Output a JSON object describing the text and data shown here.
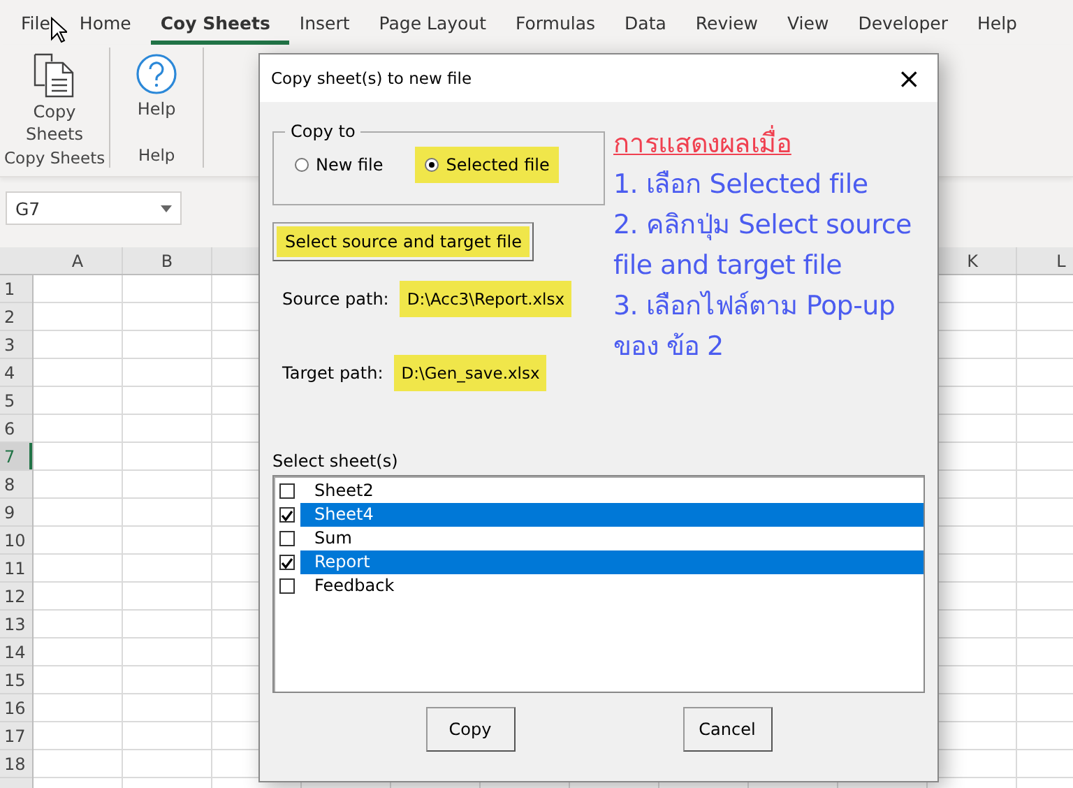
{
  "ribbon_tabs": [
    {
      "label": "File",
      "selected": false
    },
    {
      "label": "Home",
      "selected": false
    },
    {
      "label": "Coy Sheets",
      "selected": true
    },
    {
      "label": "Insert",
      "selected": false
    },
    {
      "label": "Page Layout",
      "selected": false
    },
    {
      "label": "Formulas",
      "selected": false
    },
    {
      "label": "Data",
      "selected": false
    },
    {
      "label": "Review",
      "selected": false
    },
    {
      "label": "View",
      "selected": false
    },
    {
      "label": "Developer",
      "selected": false
    },
    {
      "label": "Help",
      "selected": false
    }
  ],
  "ribbon_groups": [
    {
      "name": "Copy Sheets",
      "button": {
        "label": "Copy Sheets",
        "kind": "copy"
      }
    },
    {
      "name": "Help",
      "button": {
        "label": "Help",
        "kind": "help"
      }
    }
  ],
  "name_box": {
    "value": "G7"
  },
  "sheet": {
    "columns_left": [
      "A",
      "B"
    ],
    "columns_right": [
      "K",
      "L"
    ],
    "rows": [
      {
        "label": "1",
        "selected": false
      },
      {
        "label": "2",
        "selected": false
      },
      {
        "label": "3",
        "selected": false
      },
      {
        "label": "4",
        "selected": false
      },
      {
        "label": "5",
        "selected": false
      },
      {
        "label": "6",
        "selected": false
      },
      {
        "label": "7",
        "selected": true
      },
      {
        "label": "8",
        "selected": false
      },
      {
        "label": "9",
        "selected": false
      },
      {
        "label": "10",
        "selected": false
      },
      {
        "label": "11",
        "selected": false
      },
      {
        "label": "12",
        "selected": false
      },
      {
        "label": "13",
        "selected": false
      },
      {
        "label": "14",
        "selected": false
      },
      {
        "label": "15",
        "selected": false
      },
      {
        "label": "16",
        "selected": false
      },
      {
        "label": "17",
        "selected": false
      },
      {
        "label": "18",
        "selected": false
      }
    ]
  },
  "dialog": {
    "title": "Copy sheet(s) to new file",
    "close": "×",
    "copy_to": {
      "legend": "Copy to",
      "options": [
        {
          "label": "New file",
          "selected": false,
          "highlighted": false
        },
        {
          "label": "Selected file",
          "selected": true,
          "highlighted": true
        }
      ]
    },
    "select_button": "Select source and target file",
    "source_path": {
      "label": "Source path:",
      "value": "D:\\Acc3\\Report.xlsx"
    },
    "target_path": {
      "label": "Target path:",
      "value": "D:\\Gen_save.xlsx"
    },
    "sheets_label": "Select sheet(s)",
    "sheets": [
      {
        "name": "Sheet2",
        "checked": false,
        "selected": false
      },
      {
        "name": "Sheet4",
        "checked": true,
        "selected": true
      },
      {
        "name": "Sum",
        "checked": false,
        "selected": false
      },
      {
        "name": "Report",
        "checked": true,
        "selected": true
      },
      {
        "name": "Feedback",
        "checked": false,
        "selected": false
      }
    ],
    "buttons": [
      "Copy",
      "Cancel"
    ]
  },
  "annotation": {
    "heading": "การแสดงผลเมื่อ",
    "steps": [
      "1. เลือก Selected file",
      "2. คลิกปุ่ม Select source file and target file",
      "3. เลือกไฟล์ตาม Pop-up ของ ข้อ 2"
    ]
  }
}
